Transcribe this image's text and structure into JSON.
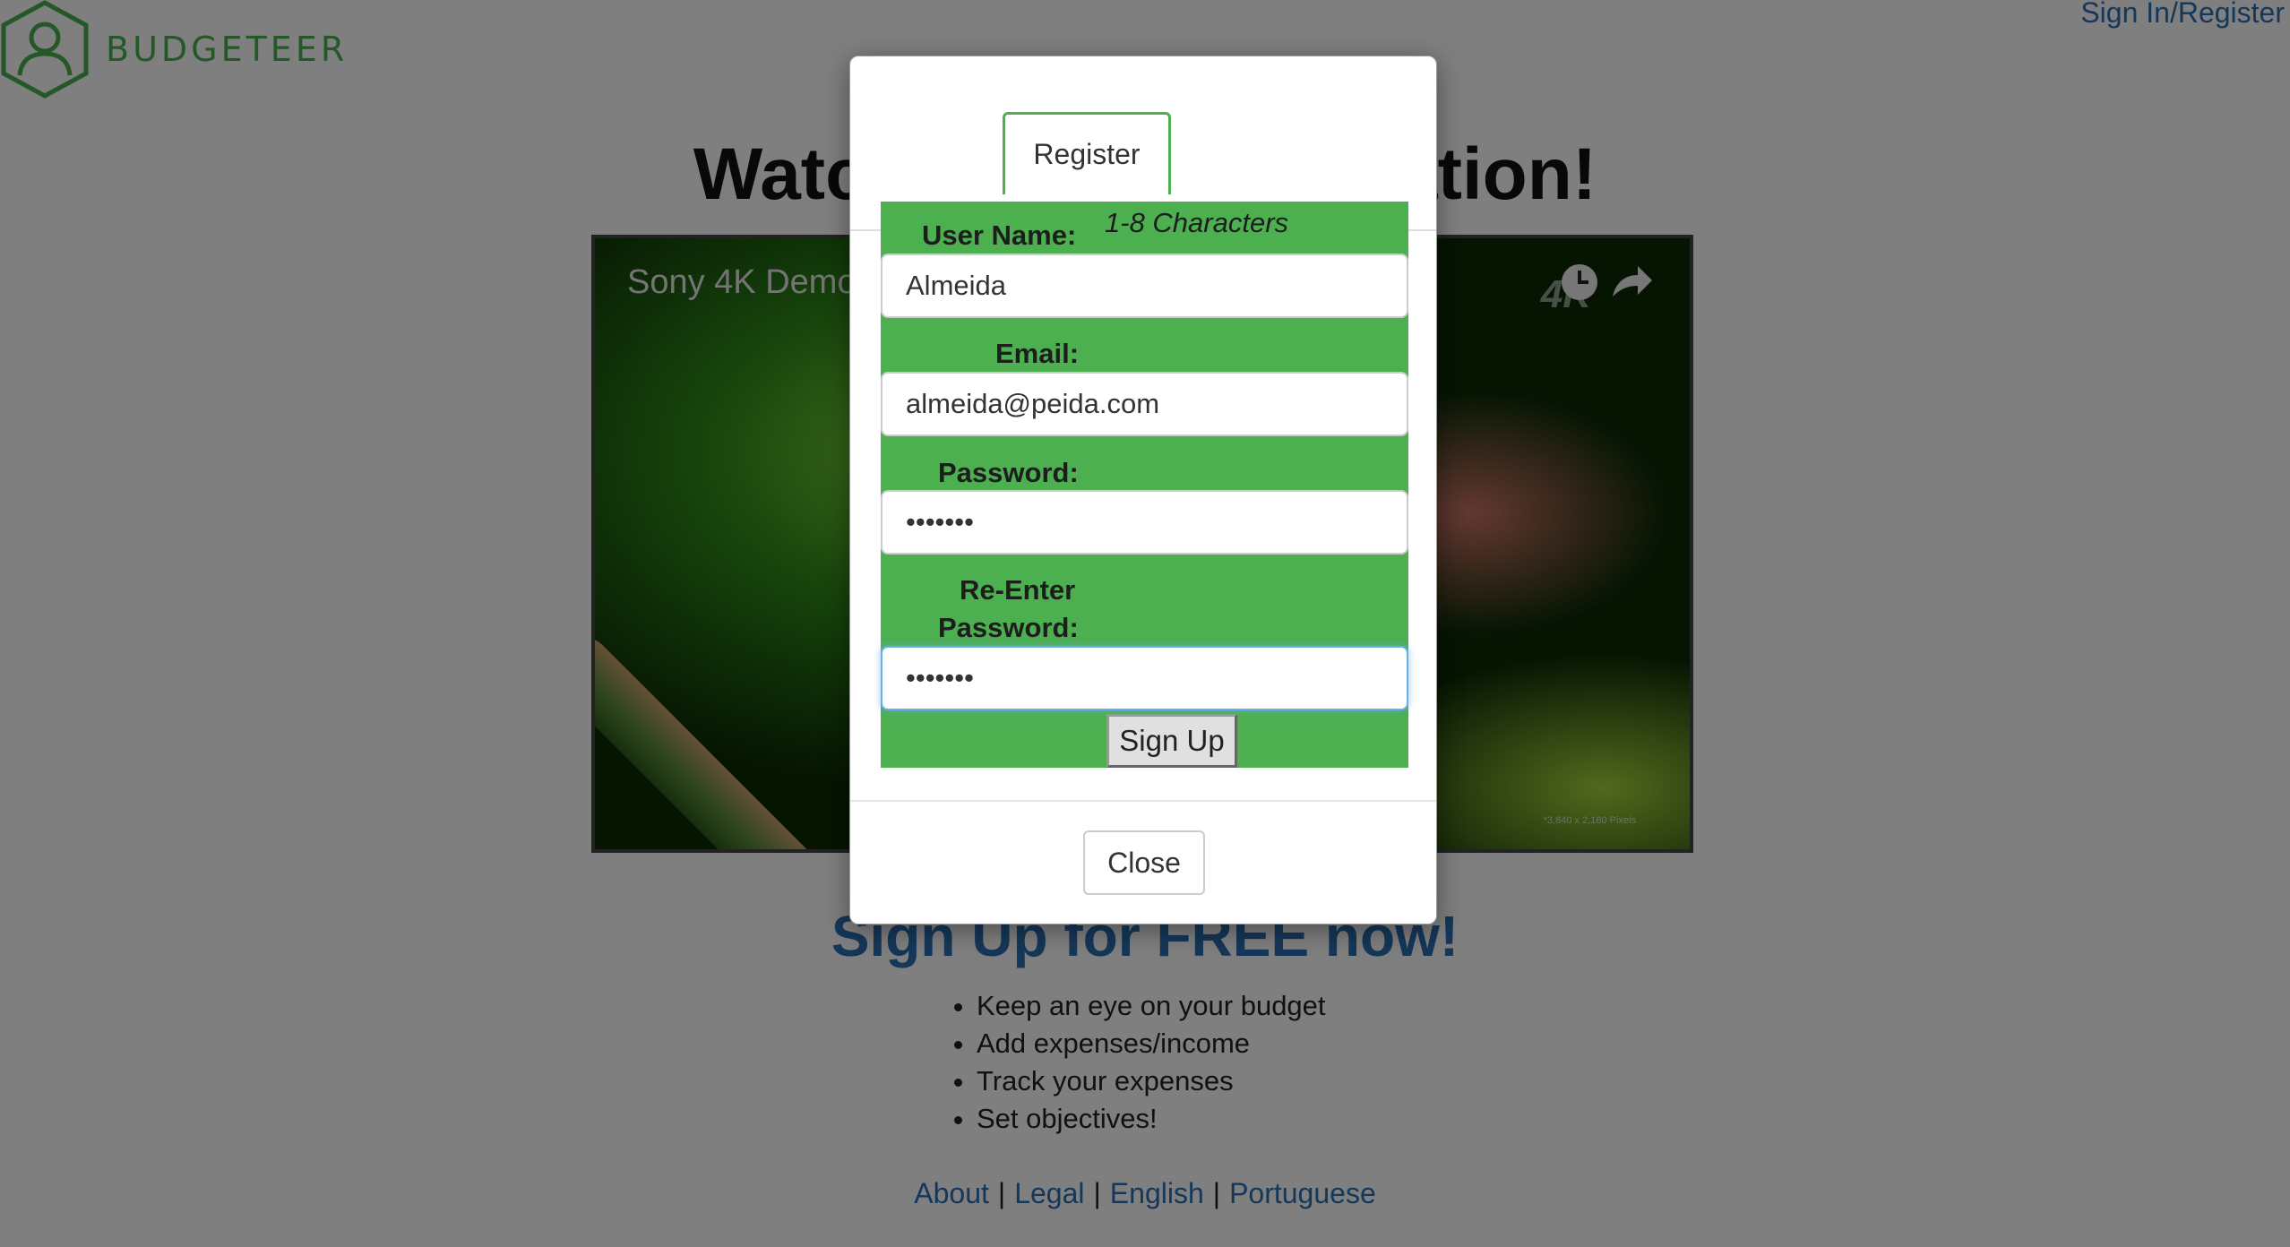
{
  "brand": {
    "name": "BUDGETEER",
    "color": "#4caf50"
  },
  "nav": {
    "signin_label": "Sign In/Register"
  },
  "hero": {
    "title": "Watch the demonstration!"
  },
  "video": {
    "title": "Sony 4K Demo",
    "badge": "4K",
    "footnote": "*3,840 x 2,160 Pixels"
  },
  "signup": {
    "title": "Sign Up for FREE now!",
    "features": [
      "Keep an eye on your budget",
      "Add expenses/income",
      "Track your expenses",
      "Set objectives!"
    ]
  },
  "footer": {
    "links": [
      "About",
      "Legal",
      "English",
      "Portuguese"
    ],
    "separator": "|"
  },
  "modal": {
    "tab_label": "Register",
    "username": {
      "label": "User Name:",
      "hint": "1-8 Characters",
      "value": "Almeida"
    },
    "email": {
      "label": "Email:",
      "value": "almeida@peida.com"
    },
    "password": {
      "label": "Password:",
      "value": "•••••••"
    },
    "reenter": {
      "label_line1": "Re-Enter",
      "label_line2": "Password:",
      "value": "•••••••"
    },
    "signup_button": "Sign Up",
    "close_button": "Close",
    "panel_color": "#4caf50"
  }
}
